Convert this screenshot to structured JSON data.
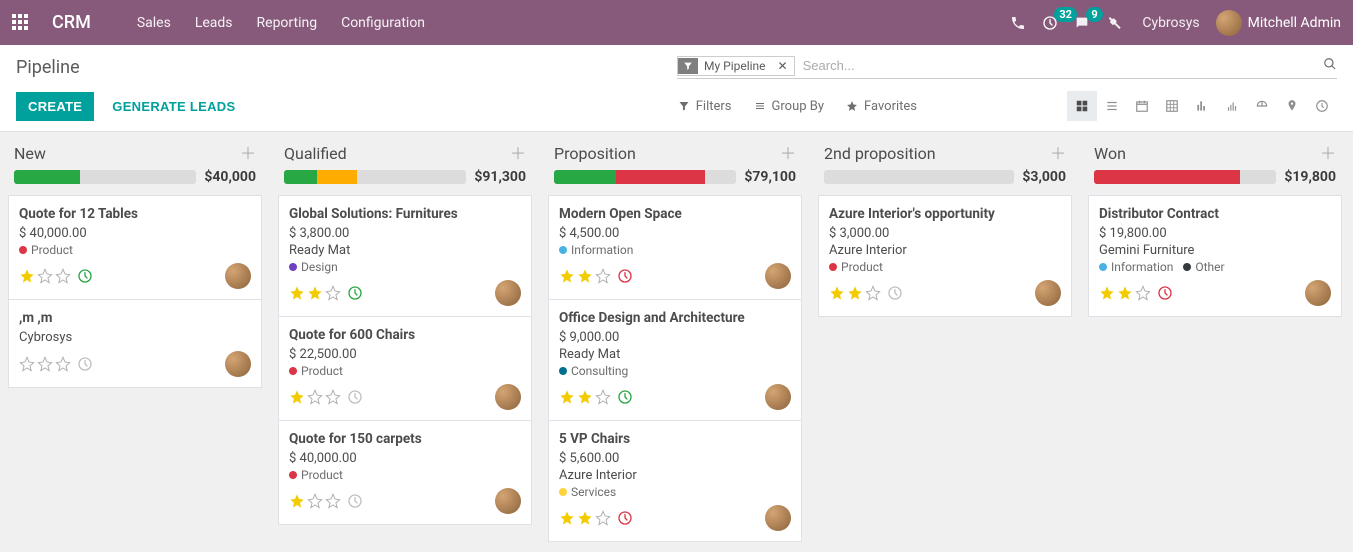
{
  "nav": {
    "brand": "CRM",
    "menu": [
      "Sales",
      "Leads",
      "Reporting",
      "Configuration"
    ],
    "activities_count": "32",
    "messages_count": "9",
    "company": "Cybrosys",
    "user": "Mitchell Admin"
  },
  "cp": {
    "title": "Pipeline",
    "facet_label": "My Pipeline",
    "search_placeholder": "Search...",
    "create": "CREATE",
    "generate": "GENERATE LEADS",
    "filters": "Filters",
    "groupby": "Group By",
    "favorites": "Favorites"
  },
  "tag_colors": {
    "Product": "#dc3545",
    "Design": "#6f42c1",
    "Information": "#4ab2e2",
    "Consulting": "#006f8f",
    "Services": "#ffd43b",
    "Other": "#343a40"
  },
  "columns": [
    {
      "title": "New",
      "total": "$40,000",
      "segments": [
        {
          "color": "green",
          "pct": 36
        }
      ],
      "cards": [
        {
          "title": "Quote for 12 Tables",
          "amount": "$ 40,000.00",
          "subs": [],
          "tags": [
            "Product"
          ],
          "stars": 1,
          "activity": "green",
          "avatar": true
        },
        {
          "title": ",m ,m",
          "amount": "",
          "subs": [
            "Cybrosys"
          ],
          "tags": [],
          "stars": 0,
          "activity": "grey",
          "avatar": true
        }
      ]
    },
    {
      "title": "Qualified",
      "total": "$91,300",
      "segments": [
        {
          "color": "green",
          "pct": 18
        },
        {
          "color": "orange",
          "pct": 22
        }
      ],
      "cards": [
        {
          "title": "Global Solutions: Furnitures",
          "amount": "$ 3,800.00",
          "subs": [
            "Ready Mat"
          ],
          "tags": [
            "Design"
          ],
          "stars": 2,
          "activity": "green",
          "avatar": true
        },
        {
          "title": "Quote for 600 Chairs",
          "amount": "$ 22,500.00",
          "subs": [],
          "tags": [
            "Product"
          ],
          "stars": 1,
          "activity": "grey",
          "avatar": true
        },
        {
          "title": "Quote for 150 carpets",
          "amount": "$ 40,000.00",
          "subs": [],
          "tags": [
            "Product"
          ],
          "stars": 1,
          "activity": "grey",
          "avatar": true
        }
      ]
    },
    {
      "title": "Proposition",
      "total": "$79,100",
      "segments": [
        {
          "color": "green",
          "pct": 34
        },
        {
          "color": "red",
          "pct": 49
        }
      ],
      "cards": [
        {
          "title": "Modern Open Space",
          "amount": "$ 4,500.00",
          "subs": [],
          "tags": [
            "Information"
          ],
          "stars": 2,
          "activity": "red",
          "avatar": true
        },
        {
          "title": "Office Design and Architecture",
          "amount": "$ 9,000.00",
          "subs": [
            "Ready Mat"
          ],
          "tags": [
            "Consulting"
          ],
          "stars": 2,
          "activity": "green",
          "avatar": true
        },
        {
          "title": "5 VP Chairs",
          "amount": "$ 5,600.00",
          "subs": [
            "Azure Interior"
          ],
          "tags": [
            "Services"
          ],
          "stars": 2,
          "activity": "red",
          "avatar": true
        }
      ]
    },
    {
      "title": "2nd proposition",
      "total": "$3,000",
      "segments": [],
      "cards": [
        {
          "title": "Azure Interior's opportunity",
          "amount": "$ 3,000.00",
          "subs": [
            "Azure Interior"
          ],
          "tags": [
            "Product"
          ],
          "stars": 2,
          "activity": "grey",
          "avatar": true
        }
      ]
    },
    {
      "title": "Won",
      "total": "$19,800",
      "segments": [
        {
          "color": "red",
          "pct": 80
        }
      ],
      "cards": [
        {
          "title": "Distributor Contract",
          "amount": "$ 19,800.00",
          "subs": [
            "Gemini Furniture"
          ],
          "tags": [
            "Information",
            "Other"
          ],
          "stars": 2,
          "activity": "red",
          "avatar": true
        }
      ]
    }
  ]
}
